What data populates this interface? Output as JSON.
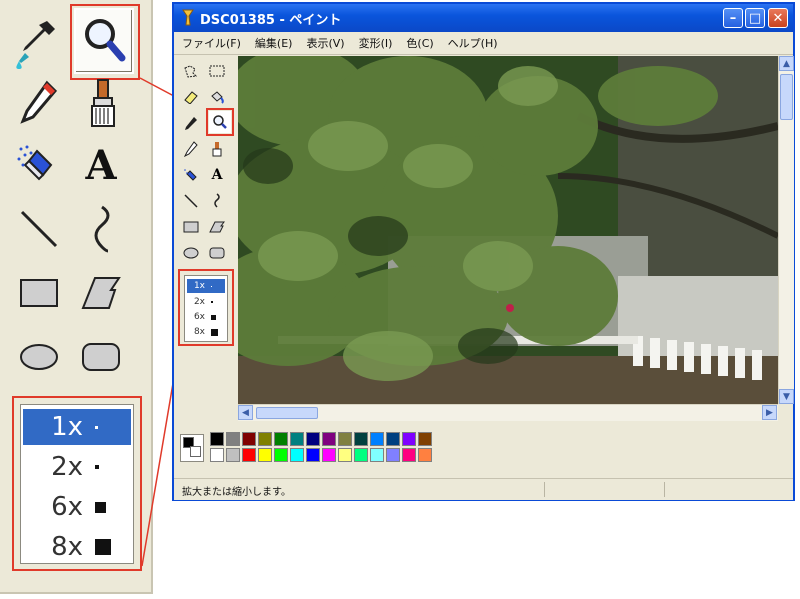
{
  "window": {
    "title": "DSC01385 - ペイント",
    "buttons": {
      "minimize": "–",
      "maximize": "□",
      "close": "✕"
    }
  },
  "menu": [
    {
      "label": "ファイル(F)"
    },
    {
      "label": "編集(E)"
    },
    {
      "label": "表示(V)"
    },
    {
      "label": "変形(I)"
    },
    {
      "label": "色(C)"
    },
    {
      "label": "ヘルプ(H)"
    }
  ],
  "tools": [
    {
      "name": "free-select",
      "icon": "free-select-icon"
    },
    {
      "name": "rect-select",
      "icon": "rect-select-icon"
    },
    {
      "name": "eraser",
      "icon": "eraser-icon"
    },
    {
      "name": "fill",
      "icon": "fill-bucket-icon"
    },
    {
      "name": "color-picker",
      "icon": "eyedropper-icon"
    },
    {
      "name": "magnifier",
      "icon": "magnifier-icon",
      "selected": true
    },
    {
      "name": "pencil",
      "icon": "pencil-icon"
    },
    {
      "name": "brush",
      "icon": "brush-icon"
    },
    {
      "name": "airbrush",
      "icon": "airbrush-icon"
    },
    {
      "name": "text",
      "icon": "text-icon",
      "glyph": "A"
    },
    {
      "name": "line",
      "icon": "line-icon"
    },
    {
      "name": "curve",
      "icon": "curve-icon"
    },
    {
      "name": "rectangle",
      "icon": "rectangle-icon"
    },
    {
      "name": "polygon",
      "icon": "polygon-icon"
    },
    {
      "name": "ellipse",
      "icon": "ellipse-icon"
    },
    {
      "name": "rounded-rect",
      "icon": "rounded-rect-icon"
    }
  ],
  "zoom_options": [
    {
      "label": "1x",
      "selected": true
    },
    {
      "label": "2x"
    },
    {
      "label": "6x"
    },
    {
      "label": "8x"
    }
  ],
  "palette": {
    "foreground": "#000000",
    "background": "#ffffff",
    "row1": [
      "#000000",
      "#808080",
      "#800000",
      "#808000",
      "#008000",
      "#008080",
      "#000080",
      "#800080",
      "#808040",
      "#004040",
      "#0080ff",
      "#004080",
      "#8000ff",
      "#804000"
    ],
    "row2": [
      "#ffffff",
      "#c0c0c0",
      "#ff0000",
      "#ffff00",
      "#00ff00",
      "#00ffff",
      "#0000ff",
      "#ff00ff",
      "#ffff80",
      "#00ff80",
      "#80ffff",
      "#8080ff",
      "#ff0080",
      "#ff8040"
    ]
  },
  "status": {
    "text": "拡大または縮小します。"
  },
  "colors": {
    "highlight": "#e03a2a",
    "selection": "#316ac5",
    "title_bar": "#0a55dc"
  }
}
